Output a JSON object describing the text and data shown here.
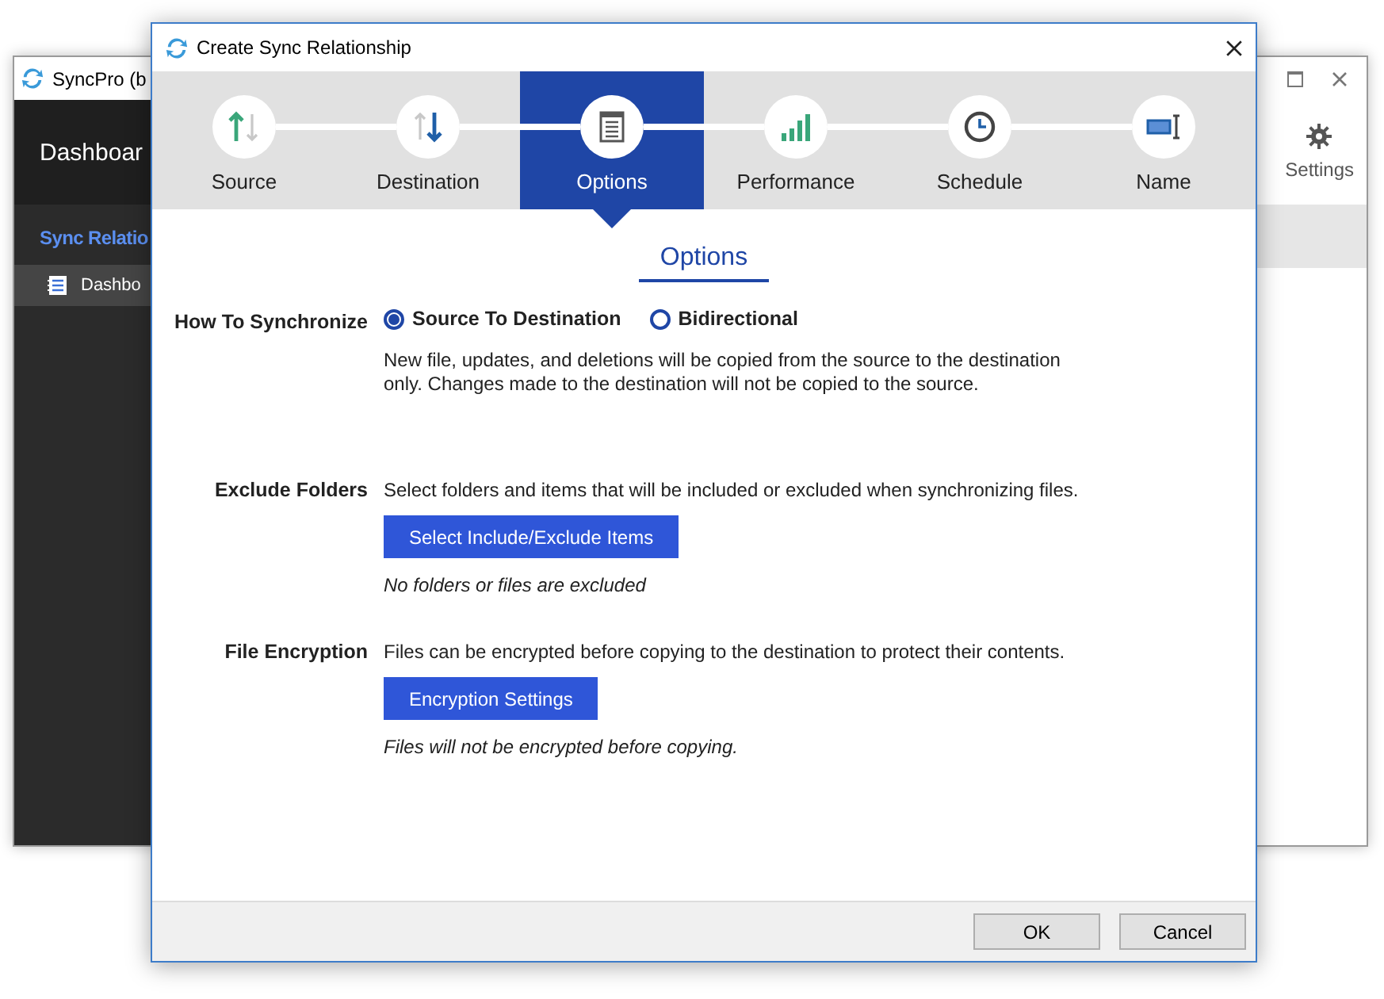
{
  "background_window": {
    "title": "SyncPro (b",
    "header": "Dashboar",
    "section": "Sync Relatio",
    "nav_items": [
      {
        "label": "Dashbo",
        "selected": true
      }
    ],
    "toolbar": [
      {
        "label": "Settings"
      }
    ]
  },
  "dialog": {
    "title": "Create Sync Relationship",
    "steps": [
      {
        "label": "Source",
        "kind": "source",
        "selected": false
      },
      {
        "label": "Destination",
        "kind": "destination",
        "selected": false
      },
      {
        "label": "Options",
        "kind": "options",
        "selected": true
      },
      {
        "label": "Performance",
        "kind": "performance",
        "selected": false
      },
      {
        "label": "Schedule",
        "kind": "schedule",
        "selected": false
      },
      {
        "label": "Name",
        "kind": "name",
        "selected": false
      }
    ],
    "heading": "Options",
    "sections": [
      {
        "kind": "radio",
        "label": "How To Synchronize",
        "options": [
          {
            "label": "Source To Destination",
            "selected": true
          },
          {
            "label": "Bidirectional",
            "selected": false
          }
        ],
        "description": "New file, updates, and deletions will be copied from the source to the destination only. Changes made to the destination will not be copied to the source."
      },
      {
        "kind": "button",
        "label": "Exclude Folders",
        "description": "Select folders and items that will be included or excluded when synchronizing files.",
        "button": "Select Include/Exclude Items",
        "note": "No folders or files are excluded"
      },
      {
        "kind": "button",
        "label": "File Encryption",
        "description": "Files can be encrypted before copying to the destination to protect their contents.",
        "button": "Encryption Settings",
        "note": "Files will not be encrypted before copying."
      }
    ],
    "buttons": [
      "OK",
      "Cancel"
    ]
  }
}
